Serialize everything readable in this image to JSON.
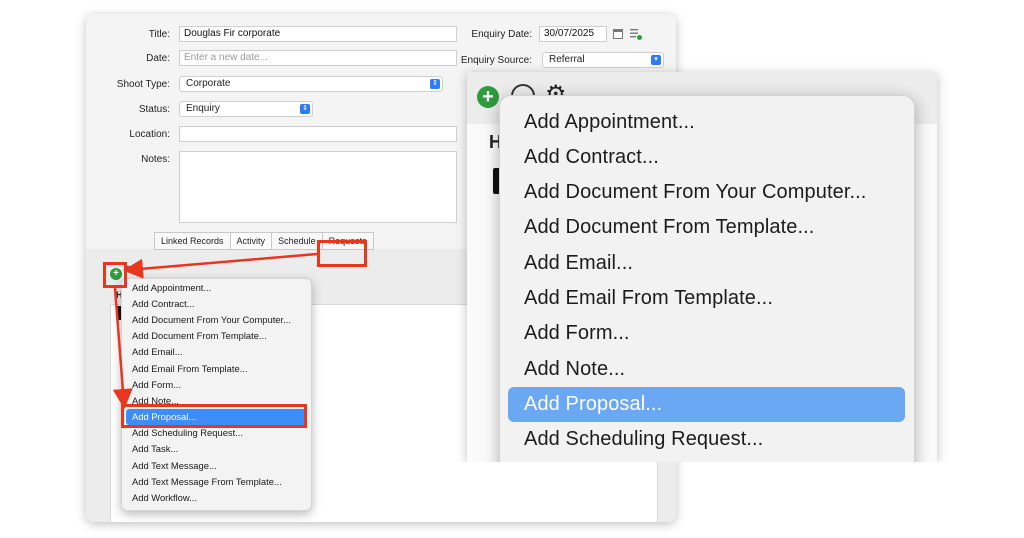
{
  "form": {
    "title_label": "Title:",
    "title_value": "Douglas Fir corporate",
    "date_label": "Date:",
    "date_placeholder": "Enter a new date...",
    "shoot_type_label": "Shoot Type:",
    "shoot_type_value": "Corporate",
    "status_label": "Status:",
    "status_value": "Enquiry",
    "location_label": "Location:",
    "notes_label": "Notes:",
    "enquiry_date_label": "Enquiry Date:",
    "enquiry_date_value": "30/07/2025",
    "enquiry_source_label": "Enquiry Source:",
    "enquiry_source_value": "Referral"
  },
  "tabs": [
    "Linked Records",
    "Activity",
    "Schedule",
    "Requests"
  ],
  "active_tab": "Activity",
  "menu_items": [
    "Add Appointment...",
    "Add Contract...",
    "Add Document From Your Computer...",
    "Add Document From Template...",
    "Add Email...",
    "Add Email From Template...",
    "Add Form...",
    "Add Note...",
    "Add Proposal...",
    "Add Scheduling Request...",
    "Add Task...",
    "Add Text Message...",
    "Add Text Message From Template...",
    "Add Workflow..."
  ],
  "selected_item": "Add Proposal...",
  "zoom_partial_header": "H",
  "colors": {
    "highlight": "#e8361f",
    "selection": "#3e8cf6",
    "add_button": "#2e9b3c"
  },
  "icons": {
    "add": "plus-circle-icon",
    "calendar": "calendar-icon",
    "list": "list-add-icon",
    "gear": "gear-icon",
    "popup": "chevron-updown-icon"
  }
}
